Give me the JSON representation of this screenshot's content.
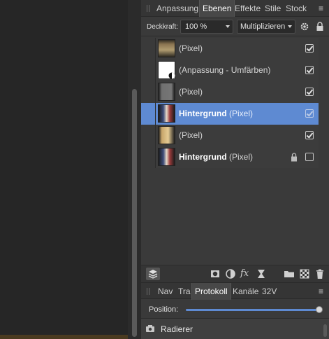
{
  "layers_panel": {
    "tabs": [
      {
        "label": "Anpassung"
      },
      {
        "label": "Ebenen",
        "active": true
      },
      {
        "label": "Effekte"
      },
      {
        "label": "Stile"
      },
      {
        "label": "Stock"
      }
    ],
    "opacity_label": "Deckkraft:",
    "opacity_value": "100 %",
    "blend_mode": "Multiplizieren",
    "layers": [
      {
        "name": "",
        "type": "(Pixel)",
        "visible": true,
        "selected": false,
        "locked": false,
        "thumb": "beige"
      },
      {
        "name": "",
        "type": "(Anpassung - Umfärben)",
        "visible": true,
        "selected": false,
        "locked": false,
        "thumb": "white"
      },
      {
        "name": "",
        "type": "(Pixel)",
        "visible": true,
        "selected": false,
        "locked": false,
        "thumb": "gray"
      },
      {
        "name": "Hintergrund",
        "type": "(Pixel)",
        "visible": true,
        "selected": true,
        "locked": false,
        "thumb": "photo"
      },
      {
        "name": "",
        "type": "(Pixel)",
        "visible": true,
        "selected": false,
        "locked": false,
        "thumb": "yellow"
      },
      {
        "name": "Hintergrund",
        "type": "(Pixel)",
        "visible": false,
        "selected": false,
        "locked": true,
        "thumb": "photo"
      }
    ]
  },
  "history_panel": {
    "tabs": [
      {
        "label": "Nav"
      },
      {
        "label": "Tra"
      },
      {
        "label": "Protokoll",
        "active": true
      },
      {
        "label": "Kanäle"
      },
      {
        "label": "32V"
      }
    ],
    "position_label": "Position:",
    "position_value": 1.0,
    "entries": [
      {
        "label": "Radierer"
      }
    ]
  },
  "colors": {
    "accent": "#5e8ad2",
    "panel_bg": "#3a3a3a",
    "workspace_bg": "#262626"
  }
}
